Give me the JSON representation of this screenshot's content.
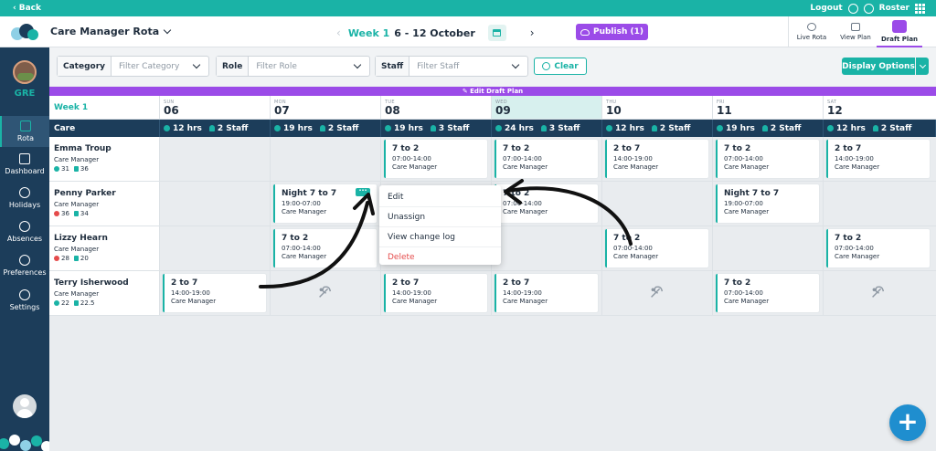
{
  "topbar": {
    "back_label": "Back",
    "logout_label": "Logout",
    "roster_label": "Roster"
  },
  "header": {
    "rota_title": "Care Manager Rota",
    "week_label": "Week 1",
    "week_dates": "6 - 12 October",
    "publish_label": "Publish (1)",
    "views": [
      {
        "label": "Live Rota",
        "icon": "clock-icon"
      },
      {
        "label": "View Plan",
        "icon": "calendar-icon"
      },
      {
        "label": "Draft Plan",
        "icon": "pencil-icon"
      }
    ]
  },
  "sidebar": {
    "org_name": "GRE",
    "items": [
      {
        "label": "Rota",
        "icon": "calendar-check-icon"
      },
      {
        "label": "Dashboard",
        "icon": "dashboard-icon"
      },
      {
        "label": "Holidays",
        "icon": "beach-icon"
      },
      {
        "label": "Absences",
        "icon": "people-icon"
      },
      {
        "label": "Preferences",
        "icon": "user-settings-icon"
      },
      {
        "label": "Settings",
        "icon": "gear-icon"
      }
    ]
  },
  "filters": {
    "category": {
      "label": "Category",
      "placeholder": "Filter Category"
    },
    "role": {
      "label": "Role",
      "placeholder": "Filter Role"
    },
    "staff": {
      "label": "Staff",
      "placeholder": "Filter Staff"
    },
    "clear_label": "Clear",
    "display_options_label": "Display Options"
  },
  "banner": {
    "draft_label": "Edit Draft Plan"
  },
  "grid": {
    "week_label": "Week 1",
    "days": [
      {
        "name": "SUN",
        "num": "06"
      },
      {
        "name": "MON",
        "num": "07"
      },
      {
        "name": "TUE",
        "num": "08"
      },
      {
        "name": "WED",
        "num": "09"
      },
      {
        "name": "THU",
        "num": "10"
      },
      {
        "name": "FRI",
        "num": "11"
      },
      {
        "name": "SAT",
        "num": "12"
      }
    ],
    "group": {
      "name": "Care",
      "stats": [
        {
          "hrs": "12 hrs",
          "staff": "2 Staff"
        },
        {
          "hrs": "19 hrs",
          "staff": "2 Staff"
        },
        {
          "hrs": "19 hrs",
          "staff": "3 Staff"
        },
        {
          "hrs": "24 hrs",
          "staff": "3 Staff"
        },
        {
          "hrs": "12 hrs",
          "staff": "2 Staff"
        },
        {
          "hrs": "19 hrs",
          "staff": "2 Staff"
        },
        {
          "hrs": "12 hrs",
          "staff": "2 Staff"
        }
      ]
    },
    "staff": [
      {
        "name": "Emma Troup",
        "role": "Care Manager",
        "stat_a": "31",
        "stat_b": "36",
        "stat_a_color": "green",
        "shifts": [
          null,
          null,
          {
            "title": "7 to 2",
            "hours": "07:00-14:00",
            "role": "Care Manager"
          },
          {
            "title": "7 to 2",
            "hours": "07:00-14:00",
            "role": "Care Manager"
          },
          {
            "title": "2 to 7",
            "hours": "14:00-19:00",
            "role": "Care Manager"
          },
          {
            "title": "7 to 2",
            "hours": "07:00-14:00",
            "role": "Care Manager"
          },
          {
            "title": "2 to 7",
            "hours": "14:00-19:00",
            "role": "Care Manager"
          }
        ]
      },
      {
        "name": "Penny Parker",
        "role": "Care Manager",
        "stat_a": "36",
        "stat_b": "34",
        "stat_a_color": "red",
        "shifts": [
          null,
          {
            "title": "Night 7 to 7",
            "hours": "19:00-07:00",
            "role": "Care Manager"
          },
          null,
          {
            "title": "7 to 2",
            "hours": "07:00-14:00",
            "role": "Care Manager"
          },
          null,
          {
            "title": "Night 7 to 7",
            "hours": "19:00-07:00",
            "role": "Care Manager"
          },
          null
        ]
      },
      {
        "name": "Lizzy Hearn",
        "role": "Care Manager",
        "stat_a": "28",
        "stat_b": "20",
        "stat_a_color": "red",
        "shifts": [
          null,
          {
            "title": "7 to 2",
            "hours": "07:00-14:00",
            "role": "Care Manager"
          },
          null,
          null,
          {
            "title": "7 to 2",
            "hours": "07:00-14:00",
            "role": "Care Manager"
          },
          null,
          {
            "title": "7 to 2",
            "hours": "07:00-14:00",
            "role": "Care Manager"
          }
        ]
      },
      {
        "name": "Terry Isherwood",
        "role": "Care Manager",
        "stat_a": "22",
        "stat_b": "22.5",
        "stat_a_color": "green",
        "shifts": [
          {
            "title": "2 to 7",
            "hours": "14:00-19:00",
            "role": "Care Manager"
          },
          "leave",
          {
            "title": "2 to 7",
            "hours": "14:00-19:00",
            "role": "Care Manager"
          },
          {
            "title": "2 to 7",
            "hours": "14:00-19:00",
            "role": "Care Manager"
          },
          "leave",
          {
            "title": "7 to 2",
            "hours": "07:00-14:00",
            "role": "Care Manager"
          },
          "leave"
        ]
      }
    ]
  },
  "context_menu": {
    "items": [
      {
        "label": "Edit"
      },
      {
        "label": "Unassign"
      },
      {
        "label": "View change log"
      },
      {
        "label": "Delete"
      }
    ]
  },
  "colors": {
    "teal": "#1ab3a6",
    "navy": "#1c3d5a",
    "purple": "#9b4be8",
    "fab_blue": "#1f8ecf",
    "danger": "#e54b4b"
  }
}
